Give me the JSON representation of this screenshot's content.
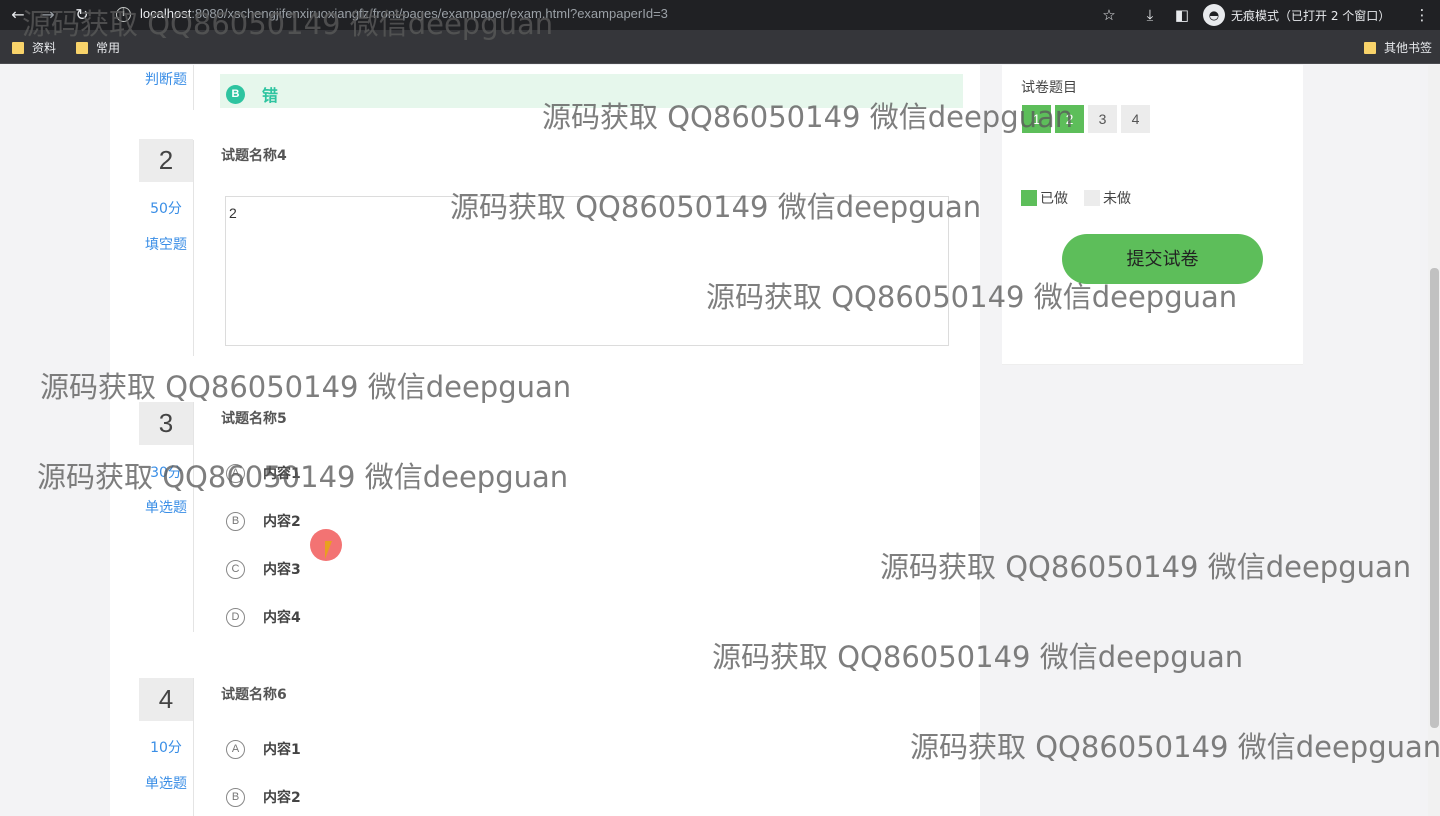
{
  "browser": {
    "url_host": "localhost",
    "url_rest": ":8080/xschengjifenxiruoxiangfz/front/pages/exampaper/exam.html?exampaperId=3",
    "incognito_label": "无痕模式（已打开 2 个窗口）",
    "bookmarks": [
      "资料",
      "常用"
    ],
    "other_bookmarks": "其他书签"
  },
  "questions": [
    {
      "type": "判断题",
      "selected_option": {
        "letter": "B",
        "text": "错"
      }
    },
    {
      "number": "2",
      "score": "50分",
      "type": "填空题",
      "title": "试题名称4",
      "answer": "2"
    },
    {
      "number": "3",
      "score": "30分",
      "type": "单选题",
      "title": "试题名称5",
      "options": [
        {
          "letter": "A",
          "text": "内容1"
        },
        {
          "letter": "B",
          "text": "内容2"
        },
        {
          "letter": "C",
          "text": "内容3"
        },
        {
          "letter": "D",
          "text": "内容4"
        }
      ]
    },
    {
      "number": "4",
      "score": "10分",
      "type": "单选题",
      "title": "试题名称6",
      "options": [
        {
          "letter": "A",
          "text": "内容1"
        },
        {
          "letter": "B",
          "text": "内容2"
        }
      ]
    }
  ],
  "panel": {
    "title": "试卷题目",
    "nav": [
      {
        "label": "1",
        "done": true
      },
      {
        "label": "2",
        "done": true
      },
      {
        "label": "3",
        "done": false
      },
      {
        "label": "4",
        "done": false
      }
    ],
    "legend_done": "已做",
    "legend_todo": "未做",
    "done_color": "#5dbe5a",
    "todo_color": "#ececec",
    "submit_label": "提交试卷"
  },
  "watermark_text": "源码获取 QQ86050149 微信deepguan"
}
